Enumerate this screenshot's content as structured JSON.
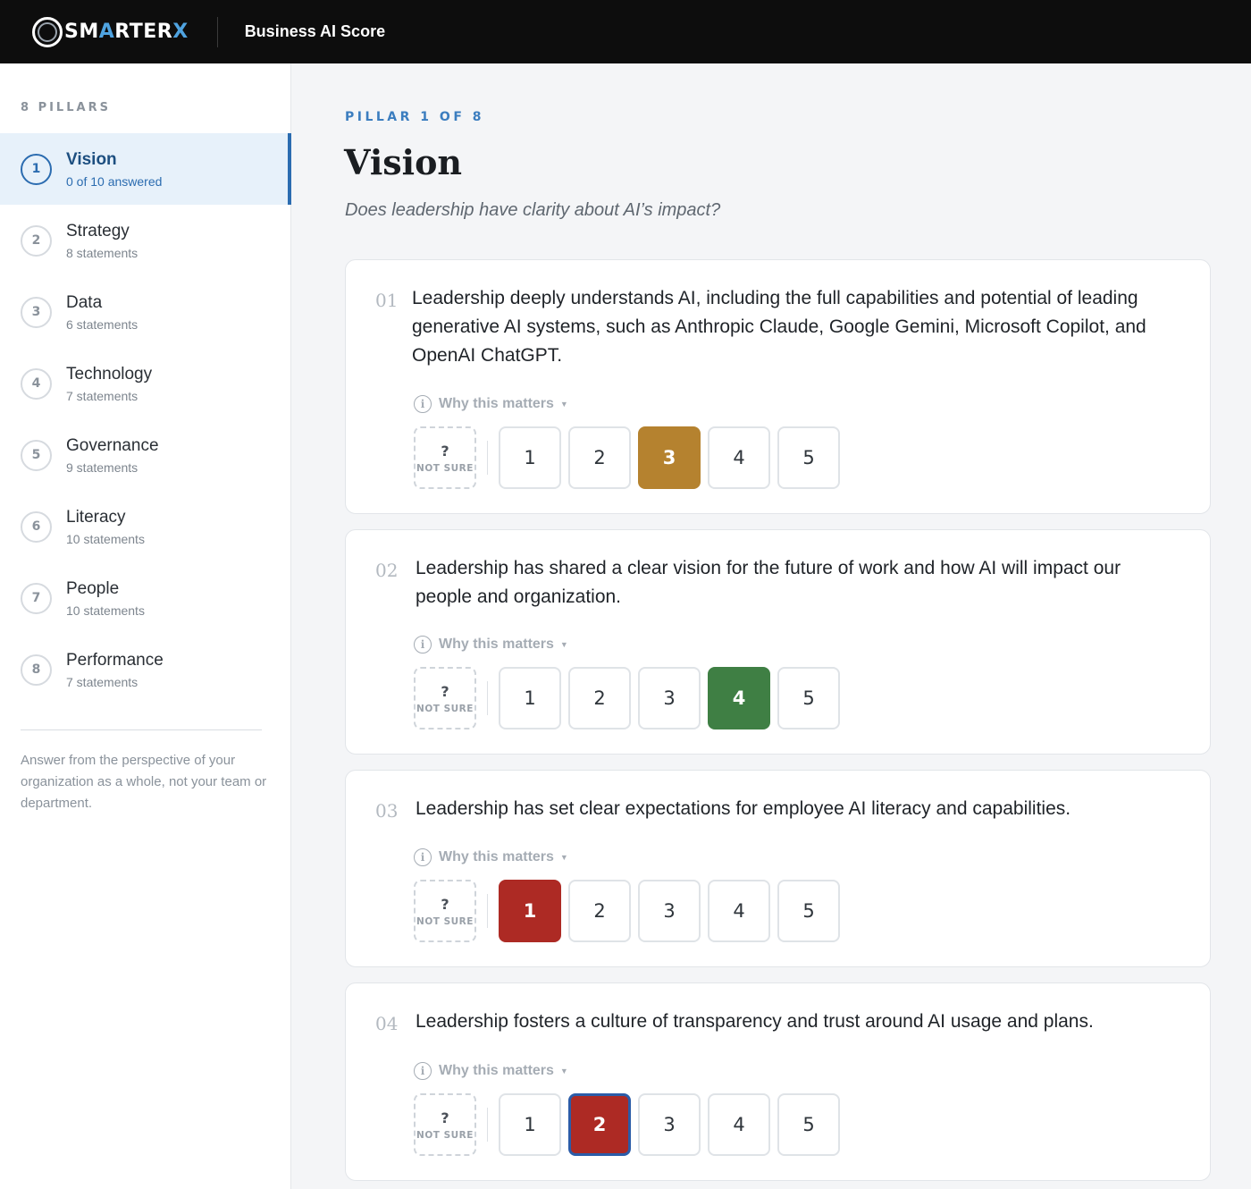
{
  "header": {
    "logo_text_pre": "SM",
    "logo_text_a": "A",
    "logo_text_mid": "RTER",
    "logo_text_x": "X",
    "app_title": "Business AI Score"
  },
  "sidebar": {
    "heading": "8 PILLARS",
    "items": [
      {
        "num": "1",
        "name": "Vision",
        "sub": "0 of 10 answered"
      },
      {
        "num": "2",
        "name": "Strategy",
        "sub": "8 statements"
      },
      {
        "num": "3",
        "name": "Data",
        "sub": "6 statements"
      },
      {
        "num": "4",
        "name": "Technology",
        "sub": "7 statements"
      },
      {
        "num": "5",
        "name": "Governance",
        "sub": "9 statements"
      },
      {
        "num": "6",
        "name": "Literacy",
        "sub": "10 statements"
      },
      {
        "num": "7",
        "name": "People",
        "sub": "10 statements"
      },
      {
        "num": "8",
        "name": "Performance",
        "sub": "7 statements"
      }
    ],
    "note": "Answer from the perspective of your organization as a whole, not your team or department."
  },
  "main": {
    "pillar_label": "PILLAR 1 OF 8",
    "title": "Vision",
    "subtitle": "Does leadership have clarity about AI’s impact?",
    "why_label": "Why this matters",
    "not_sure_q": "?",
    "not_sure_label": "NOT SURE",
    "options": [
      "1",
      "2",
      "3",
      "4",
      "5"
    ],
    "questions": [
      {
        "num": "01",
        "text": "Leadership deeply understands AI, including the full capabilities and potential of leading generative AI systems, such as Anthropic Claude, Google Gemini, Microsoft Copilot, and OpenAI ChatGPT.",
        "selected": 3
      },
      {
        "num": "02",
        "text": "Leadership has shared a clear vision for the future of work and how AI will impact our people and organization.",
        "selected": 4
      },
      {
        "num": "03",
        "text": "Leadership has set clear expectations for employee AI literacy and capabilities.",
        "selected": 1
      },
      {
        "num": "04",
        "text": "Leadership fosters a culture of transparency and trust around AI usage and plans.",
        "selected": 2
      }
    ]
  },
  "colors": {
    "accent": "#2b6cb0",
    "score_3": "#b5822f",
    "score_4": "#3f7f44",
    "score_low": "#ad2a24"
  }
}
